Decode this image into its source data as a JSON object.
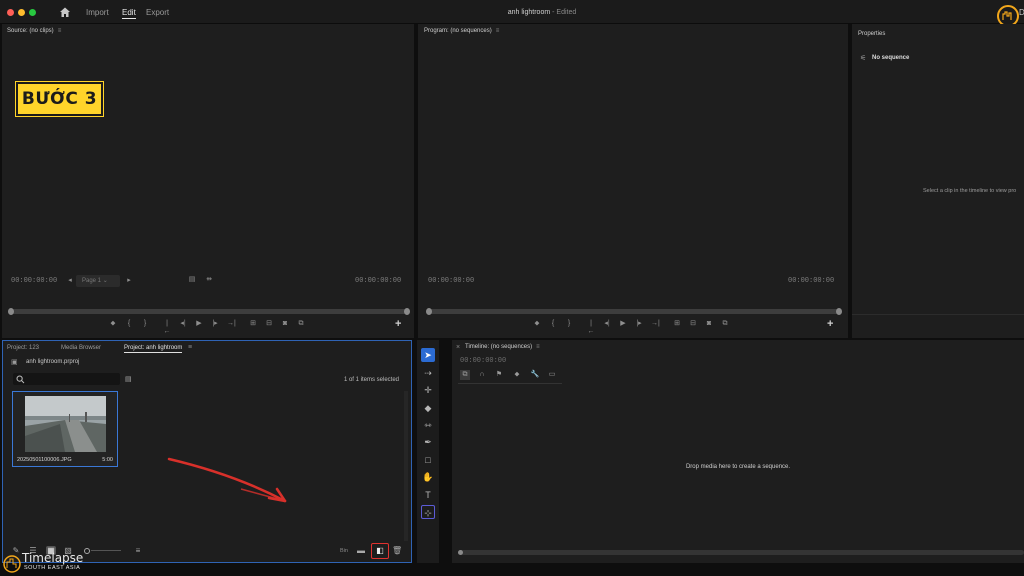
{
  "titlebar": {
    "menu": [
      "Import",
      "Edit",
      "Export"
    ],
    "active_menu": "Edit",
    "doc_title": "anh lightroom",
    "doc_status": "- Edited",
    "brand_partial": "D"
  },
  "source_monitor": {
    "title": "Source: (no clips)",
    "timecode_in": "00:00:00:00",
    "timecode_out": "00:00:00:00",
    "page_dropdown": "Page 1",
    "step_badge": "BƯỚC 3"
  },
  "program_monitor": {
    "title": "Program: (no sequences)",
    "timecode_in": "00:00:00:00",
    "timecode_out": "00:00:00:00"
  },
  "properties": {
    "title": "Properties",
    "no_sequence": "No sequence",
    "hint": "Select a clip in the timeline to view pro"
  },
  "project": {
    "tabs": [
      "Project: 123",
      "Media Browser",
      "Project: anh lightroom"
    ],
    "active_tab": "Project: anh lightroom",
    "file": "anh lightroom.prproj",
    "items_count": "1 of 1 items selected",
    "media": [
      {
        "name": "20250501100006.JPG",
        "duration": "5:00"
      }
    ],
    "bin_label": "Bin"
  },
  "timeline": {
    "title": "Timeline: (no sequences)",
    "timecode": "00:00:00:00",
    "drop_text": "Drop media here to create a sequence."
  },
  "watermark": {
    "line1": "Timelapse",
    "line2": "SOUTH EAST ASIA"
  },
  "colors": {
    "accent_blue": "#2f63b4",
    "badge_yellow": "#ffd42a",
    "highlight_red": "#e0322f",
    "annotation_arrow": "#d8302a"
  }
}
